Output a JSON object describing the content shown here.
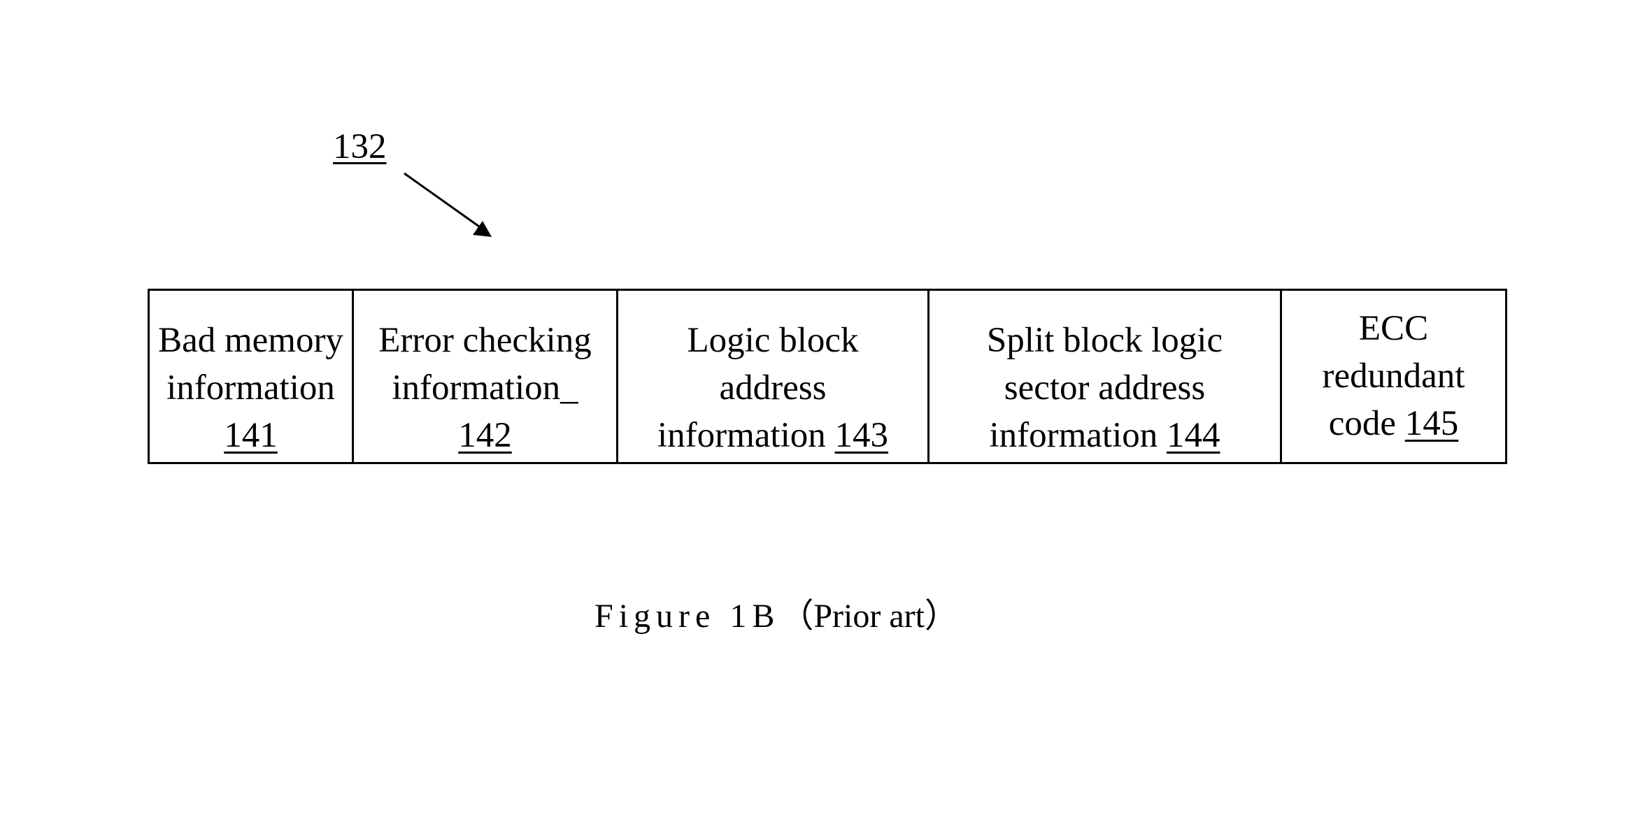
{
  "figure": {
    "reference_label": "132",
    "caption": {
      "figure_label": "Figure 1B",
      "note": "（Prior art）"
    },
    "fields": [
      {
        "lines": [
          "Bad memory",
          "information"
        ],
        "ref": "141",
        "ref_on_own_line": true
      },
      {
        "lines": [
          "Error checking",
          "information_"
        ],
        "ref": "142",
        "ref_on_own_line": true
      },
      {
        "lines": [
          "Logic block",
          "address",
          "information"
        ],
        "ref": "143",
        "ref_on_own_line": false
      },
      {
        "lines": [
          "Split block logic",
          "sector address",
          "information"
        ],
        "ref": "144",
        "ref_on_own_line": false
      },
      {
        "lines": [
          "ECC",
          "redundant",
          "code"
        ],
        "ref": "145",
        "ref_on_own_line": false
      }
    ]
  }
}
